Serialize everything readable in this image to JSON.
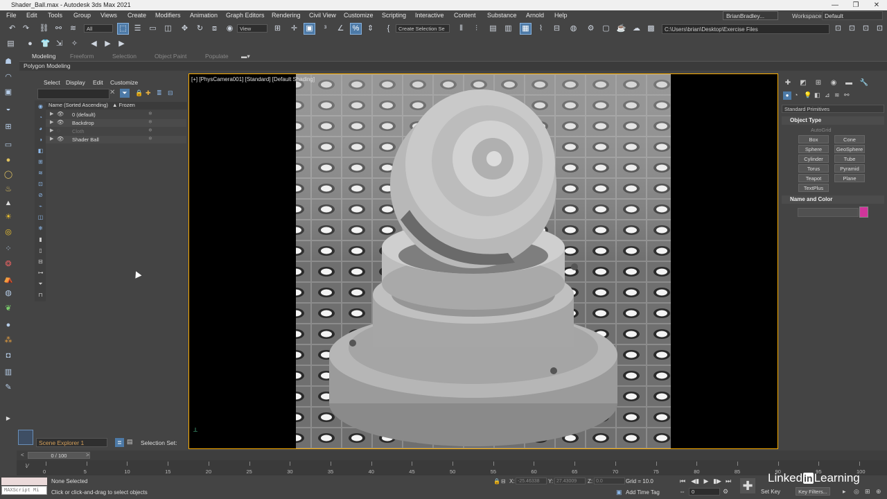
{
  "window": {
    "title": "Shader_Ball.max - Autodesk 3ds Max 2021",
    "controls": [
      "—",
      "❐",
      "✕"
    ]
  },
  "menu": [
    "File",
    "Edit",
    "Tools",
    "Group",
    "Views",
    "Create",
    "Modifiers",
    "Animation",
    "Graph Editors",
    "Rendering",
    "Civil View",
    "Customize",
    "Scripting",
    "Interactive",
    "Content",
    "Substance",
    "Arnold",
    "Help"
  ],
  "user": "BrianBradley...",
  "workspaces_label": "Workspaces:",
  "workspace": "Default",
  "toolbar": {
    "filter": "All",
    "refcoord": "View",
    "selection_set": "Create Selection Se",
    "project_path": "C:\\Users\\brian\\Desktop\\Exercise Files"
  },
  "ribbon": {
    "tabs": [
      "Modeling",
      "Freeform",
      "Selection",
      "Object Paint",
      "Populate"
    ],
    "active_tab": "Modeling",
    "panel": "Polygon Modeling"
  },
  "explorer": {
    "menu": [
      "Select",
      "Display",
      "Edit",
      "Customize"
    ],
    "col_name": "Name (Sorted Ascending)",
    "col_frozen": "▲ Frozen",
    "rows": [
      {
        "label": "0 (default)",
        "dim": false
      },
      {
        "label": "Backdrop",
        "dim": false
      },
      {
        "label": "Cloth",
        "dim": true
      },
      {
        "label": "Shader Ball",
        "dim": false
      }
    ],
    "scene_name": "Scene Explorer 1",
    "selection_set_label": "Selection Set:"
  },
  "viewport": {
    "label": "[+] [PhysCamera001] [Standard] [Default Shading]"
  },
  "command_panel": {
    "category": "Standard Primitives",
    "object_type_title": "Object Type",
    "autogrid": "AutoGrid",
    "primitives": [
      "Box",
      "Cone",
      "Sphere",
      "GeoSphere",
      "Cylinder",
      "Tube",
      "Torus",
      "Pyramid",
      "Teapot",
      "Plane",
      "TextPlus"
    ],
    "name_color_title": "Name and Color",
    "object_color": "#d0359a"
  },
  "timeline": {
    "slider": "0 / 100",
    "ticks": [
      "0",
      "5",
      "10",
      "15",
      "20",
      "25",
      "30",
      "35",
      "40",
      "45",
      "50",
      "55",
      "60",
      "65",
      "70",
      "75",
      "80",
      "85",
      "90",
      "95",
      "100"
    ]
  },
  "status": {
    "maxscript": "MAXScript Mi",
    "selected": "None Selected",
    "prompt": "Click or click-and-drag to select objects",
    "x_label": "X:",
    "x_value": "-25.46338",
    "y_label": "Y:",
    "y_value": "27.43009",
    "z_label": "Z:",
    "z_value": "0.0",
    "grid": "Grid = 10.0",
    "add_time_tag": "Add Time Tag",
    "frame": "0",
    "set_key": "Set Key",
    "key_filters": "Key Filters...",
    "brand_left": "Linked",
    "brand_in": "in",
    "brand_right": "Learning"
  }
}
